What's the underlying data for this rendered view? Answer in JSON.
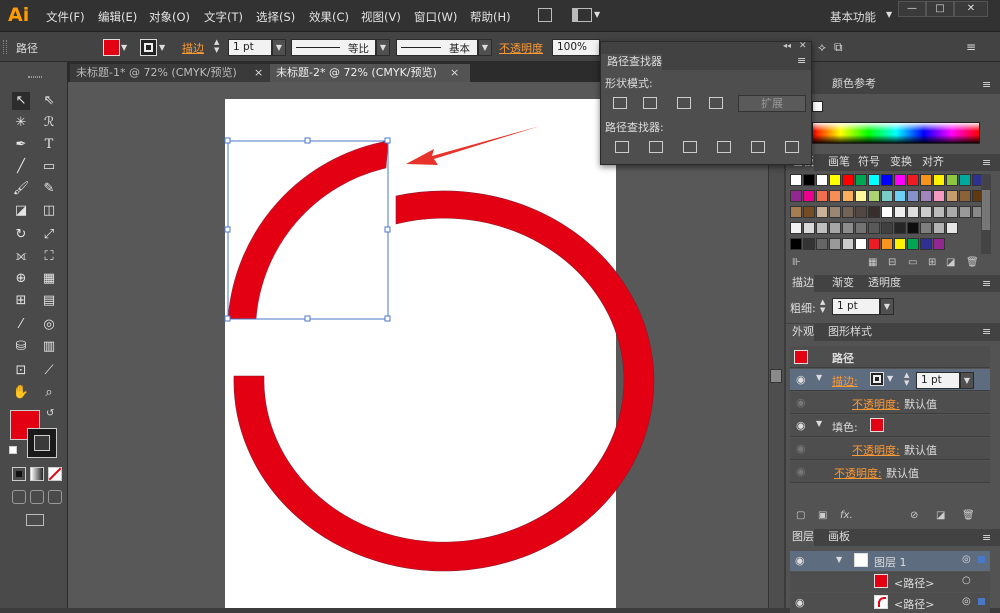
{
  "app": {
    "logo": "Ai"
  },
  "menu": [
    "文件(F)",
    "编辑(E)",
    "对象(O)",
    "文字(T)",
    "选择(S)",
    "效果(C)",
    "视图(V)",
    "窗口(W)",
    "帮助(H)"
  ],
  "workspace": "基本功能",
  "window_controls": [
    "—",
    "□",
    "✕"
  ],
  "control": {
    "object_type": "路径",
    "stroke_label": "描边",
    "stroke_value": "1 pt",
    "profile_label": "等比",
    "brush_label": "基本",
    "opacity_label": "不透明度",
    "opacity_value": "100%"
  },
  "tabs": [
    {
      "label": "未标题-1* @ 72% (CMYK/预览)",
      "close": "×"
    },
    {
      "label": "未标题-2* @ 72% (CMYK/预览)",
      "close": "×"
    }
  ],
  "pathfinder": {
    "title": "路径查找器",
    "shape_modes": "形状模式:",
    "expand": "扩展",
    "pathfinders": "路径查找器:"
  },
  "panels": {
    "color_guide": "颜色参考",
    "swatch_tabs": [
      "色板",
      "画笔",
      "符号",
      "变换",
      "对齐"
    ],
    "stroke_tabs": [
      "描边",
      "渐变",
      "透明度"
    ],
    "stroke_weight_label": "粗细:",
    "stroke_weight": "1 pt",
    "appearance_tabs": [
      "外观",
      "图形样式"
    ],
    "appearance": {
      "title": "路径",
      "stroke_label": "描边:",
      "stroke_value": "1 pt",
      "opacity1": "不透明度:",
      "opacity1_value": "默认值",
      "fill_label": "填色:",
      "opacity2": "不透明度:",
      "opacity2_value": "默认值",
      "opacity3": "不透明度:",
      "opacity3_value": "默认值",
      "fx": "fx."
    },
    "layer_tabs": [
      "图层",
      "画板"
    ],
    "layers": {
      "layer1": "图层 1",
      "path1": "<路径>",
      "path2": "<路径>"
    }
  },
  "colors": {
    "fill": "#e30012",
    "accent": "#ff9933"
  },
  "swatches": [
    [
      "#ffffff",
      "#000000",
      "#ffffff",
      "#ffff00",
      "#ff0000",
      "#00a651",
      "#00ffff",
      "#0000ff",
      "#ff00ff",
      "#ed1c24",
      "#f7941d",
      "#fff200",
      "#8dc63f",
      "#00a99d",
      "#2e3192"
    ],
    [
      "#92278f",
      "#ec008c",
      "#f26c4f",
      "#f68e56",
      "#fbaf5d",
      "#fff799",
      "#acd373",
      "#7accc8",
      "#6dcff6",
      "#8393ca",
      "#a186be",
      "#f49ac1",
      "#c69c6d",
      "#8c6239",
      "#603913"
    ],
    [
      "#a67c52",
      "#754c24",
      "#c7b299",
      "#998675",
      "#736357",
      "#534741",
      "#362f2d",
      "#fff",
      "#eee",
      "#ddd",
      "#ccc",
      "#bbb",
      "#aaa",
      "#999",
      "#888"
    ],
    [
      "#f2f2f2",
      "#d9d9d9",
      "#bfbfbf",
      "#a6a6a6",
      "#8c8c8c",
      "#737373",
      "#595959",
      "#404040",
      "#262626",
      "#0d0d0d",
      "#7f7f7f",
      "#b3b3b3",
      "#e6e6e6"
    ],
    [
      "#000000",
      "#333333",
      "#666666",
      "#999999",
      "#cccccc",
      "#ffffff",
      "#ed1c24",
      "#f7941d",
      "#fff200",
      "#00a651",
      "#2e3192",
      "#92278f"
    ]
  ]
}
